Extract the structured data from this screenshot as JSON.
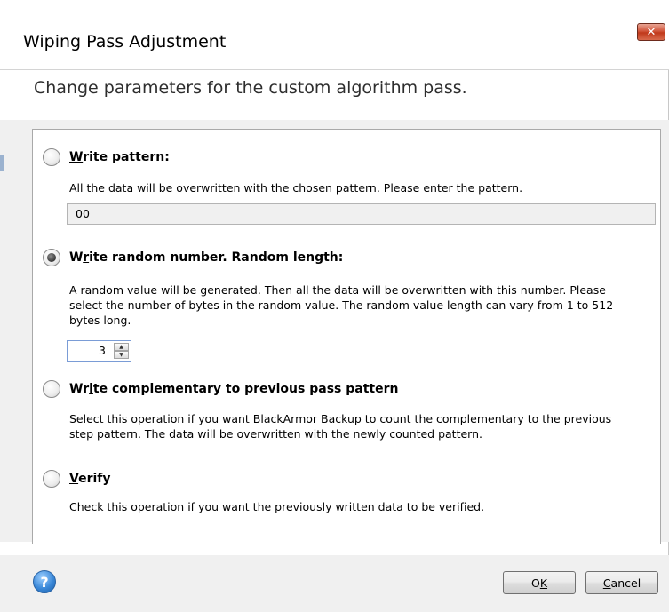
{
  "window": {
    "title": "Wiping Pass Adjustment",
    "close_glyph": "✕"
  },
  "header": {
    "subtitle": "Change parameters for the custom algorithm pass."
  },
  "options": [
    {
      "label_prefix": "",
      "label_accel": "W",
      "label_rest": "rite pattern:",
      "selected": false,
      "description": "All the data will be overwritten with the chosen pattern. Please enter the pattern."
    },
    {
      "label_prefix": "W",
      "label_accel": "r",
      "label_rest": "ite random number. Random length:",
      "selected": true,
      "description": "A random value will be generated. Then all the data will be overwritten with this number. Please select the number of bytes in the random value. The random value length can vary from 1 to 512 bytes long."
    },
    {
      "label_prefix": "Wr",
      "label_accel": "i",
      "label_rest": "te complementary to previous pass pattern",
      "selected": false,
      "description": "Select this operation if you want BlackArmor Backup to count the complementary to the previous step pattern. The data will be overwritten with the newly counted pattern."
    },
    {
      "label_prefix": "",
      "label_accel": "V",
      "label_rest": "erify",
      "selected": false,
      "description": "Check this operation if you want the previously written data to be verified."
    }
  ],
  "pattern_input": {
    "value": "00"
  },
  "random_length": {
    "value": "3"
  },
  "footer": {
    "help_glyph": "?",
    "ok_prefix": "O",
    "ok_accel": "K",
    "cancel_accel": "C",
    "cancel_rest": "ancel"
  }
}
